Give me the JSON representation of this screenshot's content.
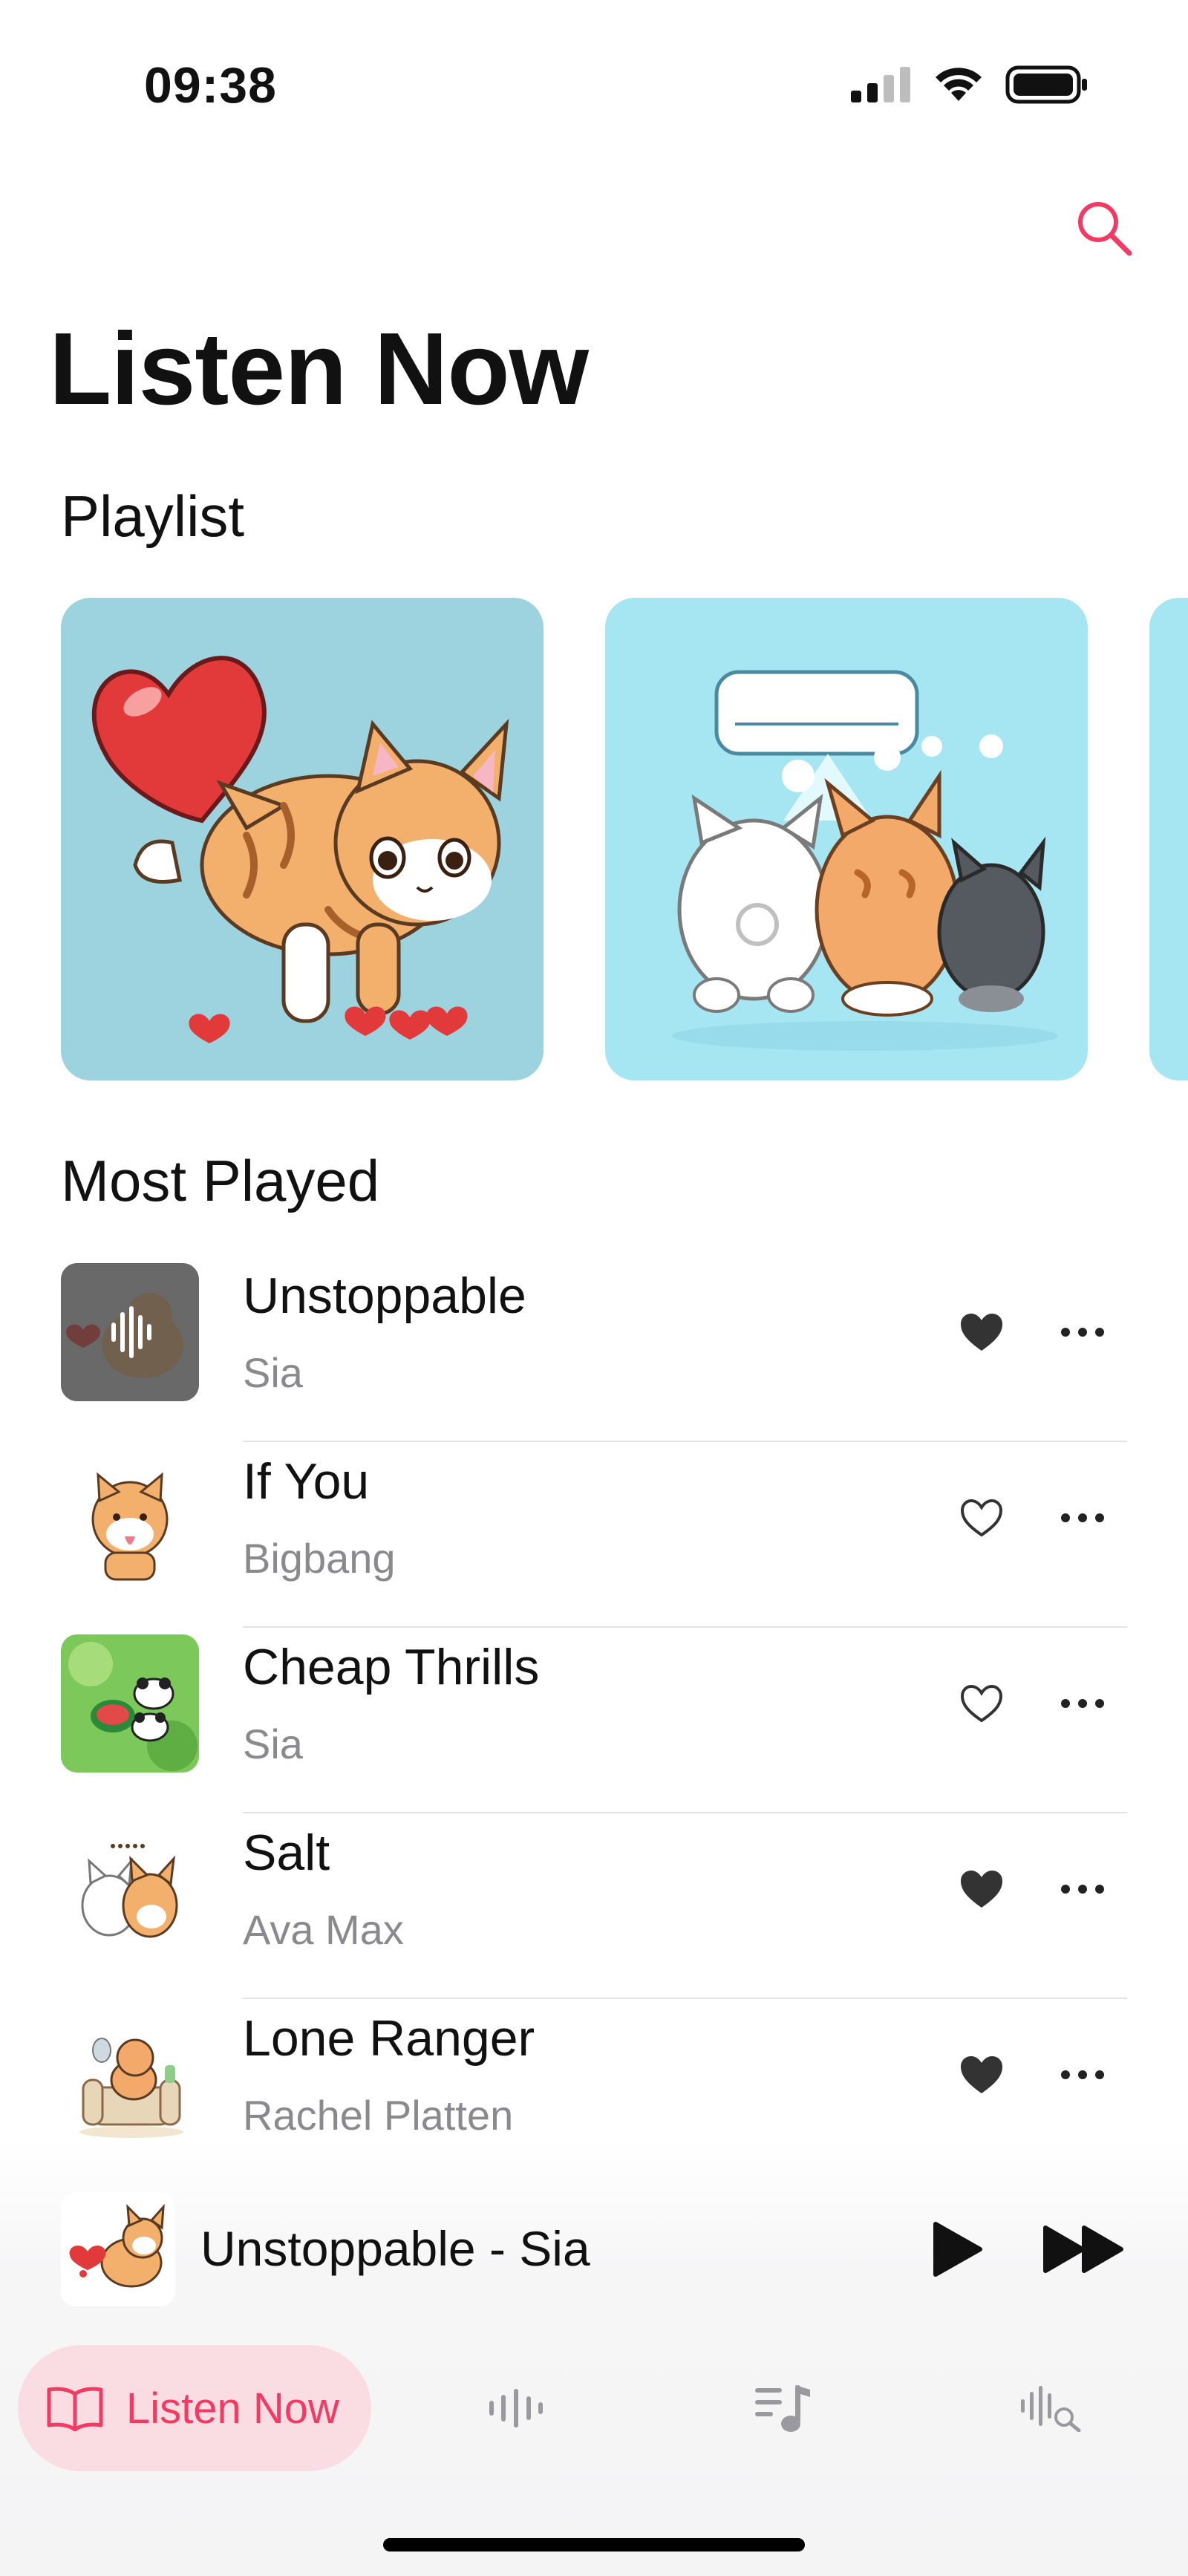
{
  "status_bar": {
    "time": "09:38"
  },
  "header": {
    "title": "Listen Now"
  },
  "sections": {
    "playlist_title": "Playlist",
    "most_played_title": "Most Played"
  },
  "playlists": [
    {
      "art": "cat-kicking-heart-illustration"
    },
    {
      "art": "cats-under-air-conditioner-illustration"
    },
    {
      "art": "partially-visible-card"
    }
  ],
  "songs": [
    {
      "title": "Unstoppable",
      "artist": "Sia",
      "liked": true,
      "playing": true
    },
    {
      "title": "If You",
      "artist": "Bigbang",
      "liked": false,
      "playing": false
    },
    {
      "title": "Cheap Thrills",
      "artist": "Sia",
      "liked": false,
      "playing": false
    },
    {
      "title": "Salt",
      "artist": "Ava Max",
      "liked": true,
      "playing": false
    },
    {
      "title": "Lone Ranger",
      "artist": "Rachel Platten",
      "liked": true,
      "playing": false
    }
  ],
  "now_playing": {
    "title": "Unstoppable - Sia"
  },
  "tabs": [
    {
      "label": "Listen Now",
      "icon": "book-icon",
      "active": true
    },
    {
      "label": "",
      "icon": "waveform-icon",
      "active": false
    },
    {
      "label": "",
      "icon": "music-list-icon",
      "active": false
    },
    {
      "label": "",
      "icon": "waveform-search-icon",
      "active": false
    }
  ],
  "colors": {
    "accent": "#f23a63",
    "active_tab_bg": "#f9dde3",
    "secondary_text": "#8a8a8e",
    "divider": "#e3e3e6"
  }
}
